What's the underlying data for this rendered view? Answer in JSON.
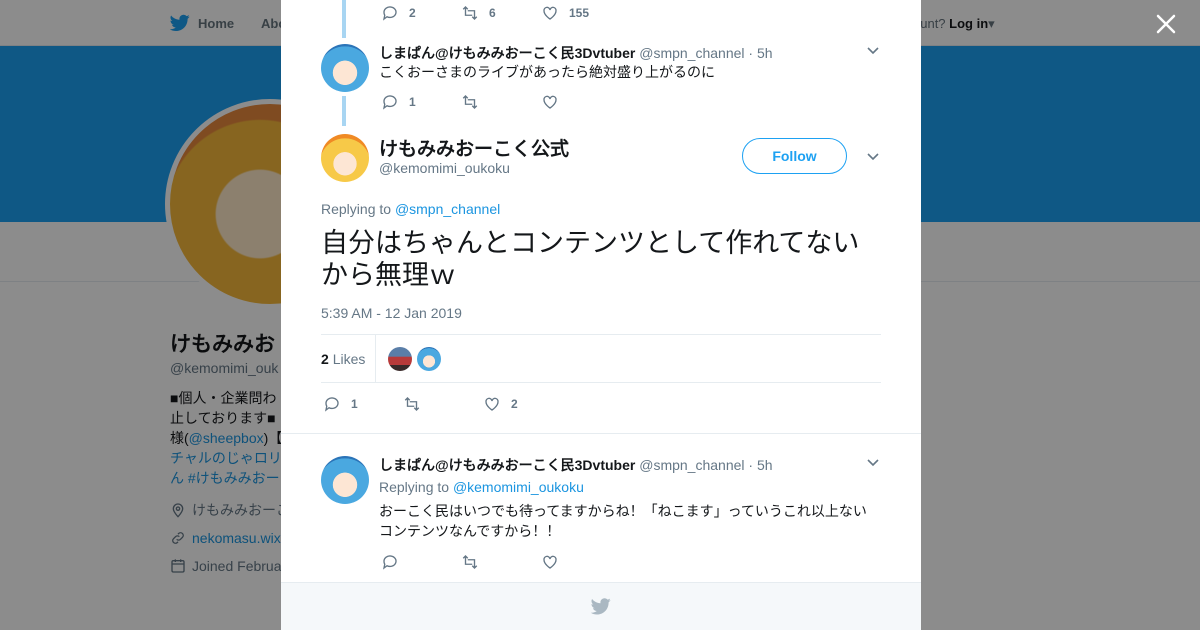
{
  "nav": {
    "home_label": "Home",
    "about_label": "Abo",
    "account_prompt": "ccount?",
    "login_label": "Log in"
  },
  "profile": {
    "name": "けもみみお",
    "handle": "@kemomimi_ouk",
    "bio_line1": "■個人・企業問わ",
    "bio_line2": "止しております■",
    "bio_line3_pre": "様(",
    "bio_line3_mention": "@sheepbox",
    "bio_line3_post": ")【",
    "bio_line4": "チャルのじゃロリ",
    "bio_line5": "ん #けもみみおー",
    "location": "けもみみおーこ",
    "website": "nekomasu.wix",
    "joined": "Joined Februa"
  },
  "modal": {
    "prev_tweet_actions": {
      "replies": "2",
      "retweets": "6",
      "likes": "155"
    },
    "reply1": {
      "name": "しまぱん@けもみみおーこく民3Dvtuber",
      "handle": "@smpn_channel",
      "time": "· 5h",
      "text": "こくおーさまのライブがあったら絶対盛り上がるのに",
      "replies": "1",
      "retweets": "",
      "likes": ""
    },
    "main": {
      "name": "けもみみおーこく公式",
      "handle": "@kemomimi_oukoku",
      "follow_label": "Follow",
      "replying_to_label": "Replying to",
      "replying_to_mention": "@smpn_channel",
      "text": "自分はちゃんとコンテンツとして作れてないから無理ｗ",
      "timestamp": "5:39 AM - 12 Jan 2019",
      "likes_count": "2",
      "likes_label": "Likes",
      "replies": "1",
      "retweets": "",
      "likes": "2"
    },
    "reply2": {
      "name": "しまぱん@けもみみおーこく民3Dvtuber",
      "handle": "@smpn_channel",
      "time": "· 5h",
      "replying_to_label": "Replying to",
      "replying_to_mention": "@kemomimi_oukoku",
      "text": "おーこく民はいつでも待ってますからね！「ねこます」っていうこれ以上ないコンテンツなんですから！！",
      "replies": "",
      "retweets": "",
      "likes": ""
    }
  },
  "colors": {
    "twitter_blue": "#1da1f2",
    "link": "#1b95e0",
    "muted": "#657786",
    "thread_line": "#a8d5f2"
  }
}
